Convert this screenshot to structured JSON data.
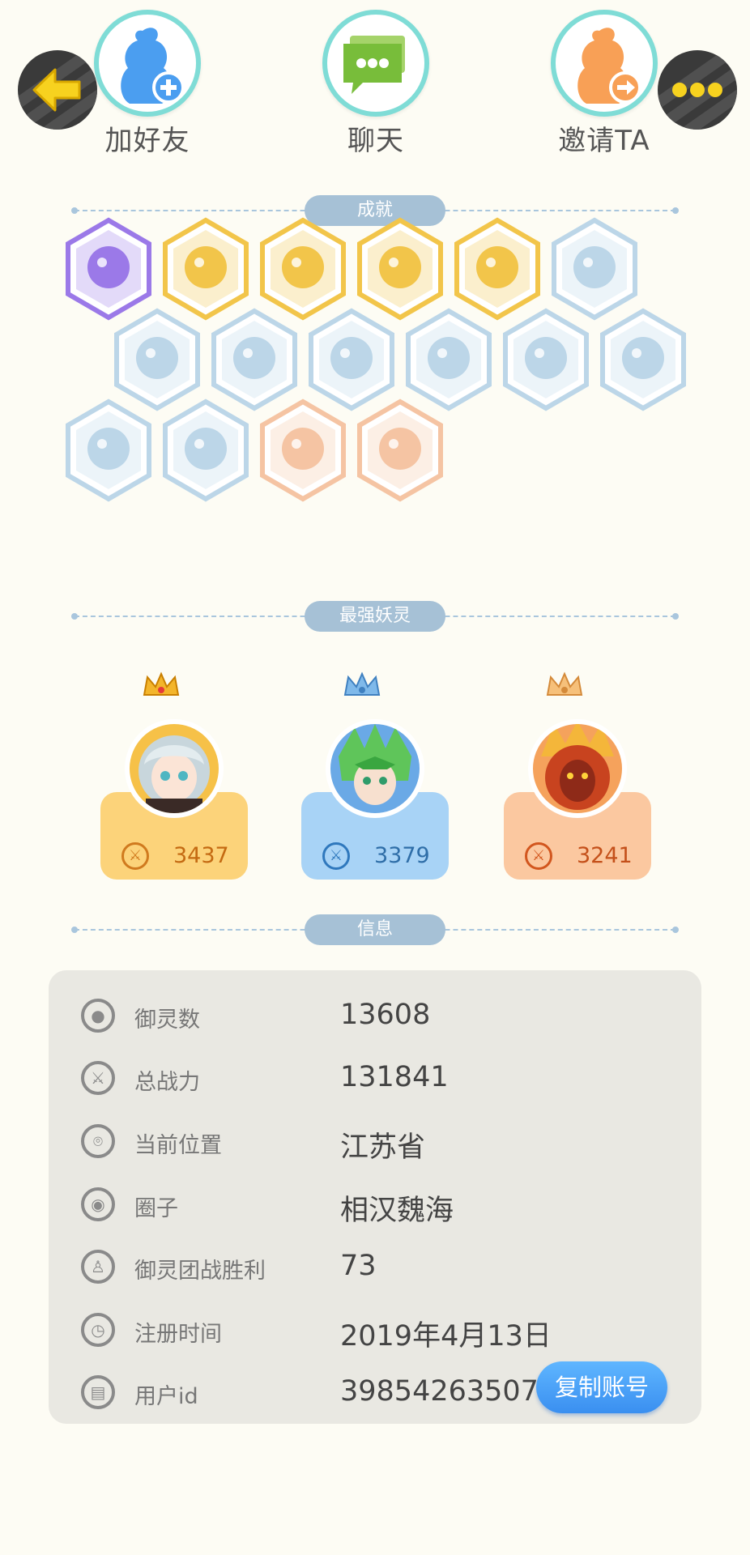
{
  "actions": {
    "add_friend": "加好友",
    "chat": "聊天",
    "invite": "邀请TA"
  },
  "sections": {
    "achievements": "成就",
    "strongest": "最强妖灵",
    "info": "信息"
  },
  "achievement_badges": [
    {
      "name": "purple-demon",
      "color": "#9b79e8"
    },
    {
      "name": "gold-orb",
      "color": "#f2c54a"
    },
    {
      "name": "gold-taiji-swirl",
      "color": "#f2c54a"
    },
    {
      "name": "gold-taiji-tablet",
      "color": "#f2c54a"
    },
    {
      "name": "gold-fox-book",
      "color": "#f2c54a"
    },
    {
      "name": "blue-sneaker",
      "color": "#bcd6e8"
    },
    {
      "name": "blue-portal",
      "color": "#bcd6e8"
    },
    {
      "name": "blue-moons",
      "color": "#bcd6e8"
    },
    {
      "name": "blue-crystal",
      "color": "#bcd6e8"
    },
    {
      "name": "blue-dragon-statue",
      "color": "#bcd6e8"
    },
    {
      "name": "blue-stroller",
      "color": "#bcd6e8"
    },
    {
      "name": "blue-cat-balloon",
      "color": "#bcd6e8"
    },
    {
      "name": "blue-shield",
      "color": "#bcd6e8"
    },
    {
      "name": "blue-ghost-cat",
      "color": "#bcd6e8"
    },
    {
      "name": "orange-fish-spirit",
      "color": "#f5c4a3"
    },
    {
      "name": "orange-horned-statue",
      "color": "#f5c4a3"
    }
  ],
  "pets": [
    {
      "name": "pet-silver-hair",
      "power": "3437",
      "theme": "gold"
    },
    {
      "name": "pet-green-leaf",
      "power": "3379",
      "theme": "blue"
    },
    {
      "name": "pet-fire-demon",
      "power": "3241",
      "theme": "orange"
    }
  ],
  "info": [
    {
      "key": "御灵数",
      "value": "13608",
      "icon": "spirit-icon"
    },
    {
      "key": "总战力",
      "value": "131841",
      "icon": "sword-icon"
    },
    {
      "key": "当前位置",
      "value": "江苏省",
      "icon": "location-pin-icon"
    },
    {
      "key": "圈子",
      "value": "相汉魏海",
      "icon": "circle-target-icon"
    },
    {
      "key": "御灵团战胜利",
      "value": "73",
      "icon": "trophy-figure-icon"
    },
    {
      "key": "注册时间",
      "value": "2019年4月13日",
      "icon": "clock-icon"
    },
    {
      "key": "用户id",
      "value": "39854263507",
      "icon": "id-card-icon"
    }
  ],
  "copy_button": "复制账号",
  "colors": {
    "accent_teal": "#7fdcd6",
    "pill": "#a6c1d6",
    "gold_card": "#fcd37a",
    "blue_card": "#a8d3f6",
    "orange_card": "#fbc8a0",
    "copy_button": "#4aa3f8"
  }
}
